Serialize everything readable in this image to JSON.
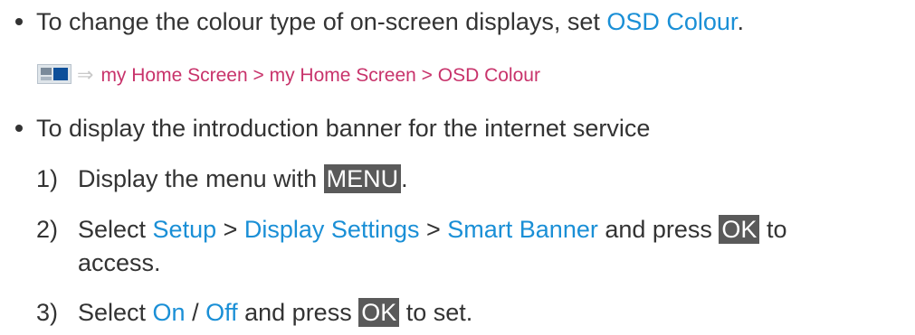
{
  "item1": {
    "text": "To change the colour type of on-screen displays, set ",
    "link": "OSD Colour",
    "end": "."
  },
  "path": {
    "icon": "home-screen-icon",
    "arrow": "⇒",
    "text": "my Home Screen > my Home Screen > OSD Colour"
  },
  "item2": {
    "text": "To display the introduction banner for the internet service"
  },
  "steps": [
    {
      "num": "1)",
      "pre": "Display the menu with ",
      "key": "MENU",
      "post": "."
    },
    {
      "num": "2)",
      "pre": "Select ",
      "link1": "Setup",
      "sep1": " > ",
      "link2": "Display Settings",
      "sep2": " > ",
      "link3": "Smart Banner",
      "mid": " and press ",
      "key": "OK",
      "post": " to",
      "cont": "access."
    },
    {
      "num": "3)",
      "pre": "Select ",
      "link1": "On",
      "sep1": " / ",
      "link2": "Off",
      "mid": " and press ",
      "key": "OK",
      "post": " to set."
    }
  ],
  "colors": {
    "text": "#333333",
    "link": "#1a8fd6",
    "path": "#c8336b",
    "key_bg": "#5a5a5a"
  }
}
